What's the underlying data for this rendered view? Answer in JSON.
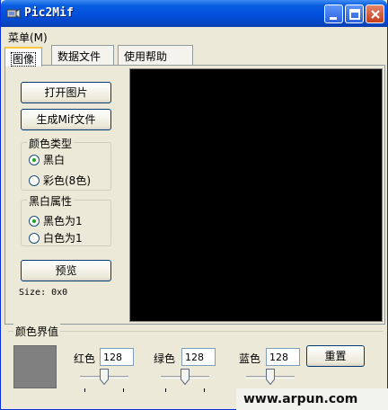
{
  "window": {
    "title": "Pic2Mif"
  },
  "menu": {
    "label": "菜单(M)"
  },
  "tabs": [
    {
      "label": "图像"
    },
    {
      "label": "数据文件"
    },
    {
      "label": "使用帮助"
    }
  ],
  "buttons": {
    "open_image": "打开图片",
    "generate_mif": "生成Mif文件",
    "preview": "预览",
    "reset": "重置"
  },
  "color_type": {
    "title": "颜色类型",
    "options": [
      {
        "label": "黑白",
        "checked": true
      },
      {
        "label": "彩色(8色)",
        "checked": false
      }
    ]
  },
  "bw_attr": {
    "title": "黑白属性",
    "options": [
      {
        "label": "黑色为1",
        "checked": true
      },
      {
        "label": "白色为1",
        "checked": false
      }
    ]
  },
  "size_text": "Size: 0x0",
  "threshold": {
    "title": "颜色界值",
    "swatch_color": "#808080",
    "channels": [
      {
        "label": "红色",
        "value": "128",
        "level": 128
      },
      {
        "label": "绿色",
        "value": "128",
        "level": 128
      },
      {
        "label": "蓝色",
        "value": "128",
        "level": 128
      }
    ]
  },
  "watermark": "www.arpun.com"
}
